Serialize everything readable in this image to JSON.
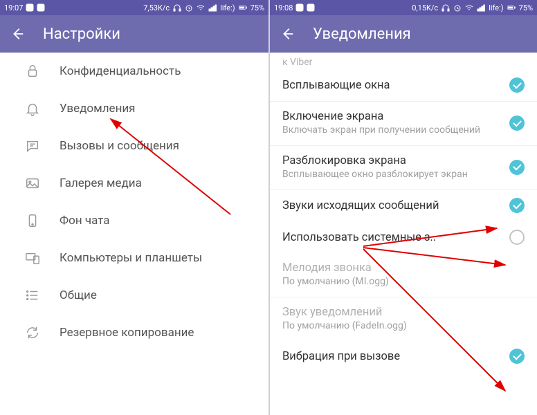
{
  "left": {
    "status": {
      "time": "19:07",
      "speed": "7,53K/c",
      "carrier": "life:)",
      "battery": "75%"
    },
    "header": {
      "title": "Настройки"
    },
    "items": [
      {
        "label": "Конфиденциальность",
        "icon": "lock"
      },
      {
        "label": "Уведомления",
        "icon": "bell"
      },
      {
        "label": "Вызовы и сообщения",
        "icon": "chat"
      },
      {
        "label": "Галерея медиа",
        "icon": "image"
      },
      {
        "label": "Фон чата",
        "icon": "phone"
      },
      {
        "label": "Компьютеры и планшеты",
        "icon": "devices"
      },
      {
        "label": "Общие",
        "icon": "list"
      },
      {
        "label": "Резервное копирование",
        "icon": "refresh"
      }
    ]
  },
  "right": {
    "status": {
      "time": "19:08",
      "speed": "0,15K/c",
      "carrier": "life:)",
      "battery": "75%"
    },
    "header": {
      "title": "Уведомления"
    },
    "top_scroll": "к Viber",
    "items": [
      {
        "title": "Всплывающие окна",
        "sub": "",
        "on": true,
        "bordered": false,
        "disabled": false
      },
      {
        "title": "Включение экрана",
        "sub": "Включать экран при получении сообщений",
        "on": true,
        "bordered": true,
        "disabled": false
      },
      {
        "title": "Разблокировка экрана",
        "sub": "Всплывающее окно разблокирует экран",
        "on": true,
        "bordered": true,
        "disabled": false
      },
      {
        "title": "Звуки исходящих сообщений",
        "sub": "",
        "on": true,
        "bordered": true,
        "disabled": false
      },
      {
        "title": "Использовать системные з..",
        "sub": "",
        "on": false,
        "bordered": false,
        "disabled": false
      },
      {
        "title": "Мелодия звонка",
        "sub": "По умолчанию (MI.ogg)",
        "on": null,
        "bordered": false,
        "disabled": true
      },
      {
        "title": "Звук уведомлений",
        "sub": "По умолчанию (FadeIn.ogg)",
        "on": null,
        "bordered": true,
        "disabled": true
      },
      {
        "title": "Вибрация при вызове",
        "sub": "",
        "on": true,
        "bordered": false,
        "disabled": false
      }
    ]
  }
}
